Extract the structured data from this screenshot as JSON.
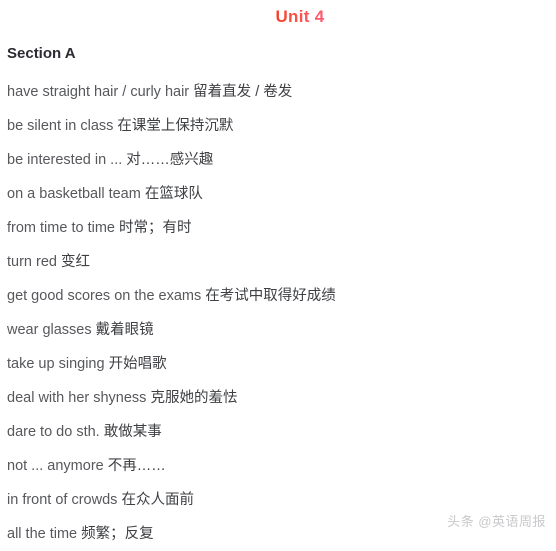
{
  "document": {
    "unit_heading": "Unit 4",
    "section_heading": "Section A",
    "phrases": [
      {
        "en": "have straight hair / curly hair",
        "zh": "留着直发 / 卷发"
      },
      {
        "en": "be silent in class",
        "zh": "在课堂上保持沉默"
      },
      {
        "en": "be interested in ...",
        "zh": "对……感兴趣"
      },
      {
        "en": "on a basketball team",
        "zh": "在篮球队"
      },
      {
        "en": "from time to time",
        "zh": "时常；有时"
      },
      {
        "en": "turn red",
        "zh": "变红"
      },
      {
        "en": "get good scores on the exams",
        "zh": "在考试中取得好成绩"
      },
      {
        "en": "wear glasses",
        "zh": "戴着眼镜"
      },
      {
        "en": "take up singing",
        "zh": "开始唱歌"
      },
      {
        "en": "deal with her shyness",
        "zh": "克服她的羞怯"
      },
      {
        "en": "dare to do sth.",
        "zh": "敢做某事"
      },
      {
        "en": "not ... anymore",
        "zh": "不再……"
      },
      {
        "en": "in front of crowds",
        "zh": "在众人面前"
      },
      {
        "en": "all the time",
        "zh": "频繁；反复"
      }
    ]
  },
  "watermark": {
    "text": "头条 @英语周报"
  },
  "colors": {
    "background": "#ffffff",
    "unit_heading_start": "#f4402a",
    "unit_heading_end": "#fc5c74",
    "section_heading": "#2b2b33",
    "body_text": "#57585c",
    "watermark": "#c9c9cc"
  }
}
